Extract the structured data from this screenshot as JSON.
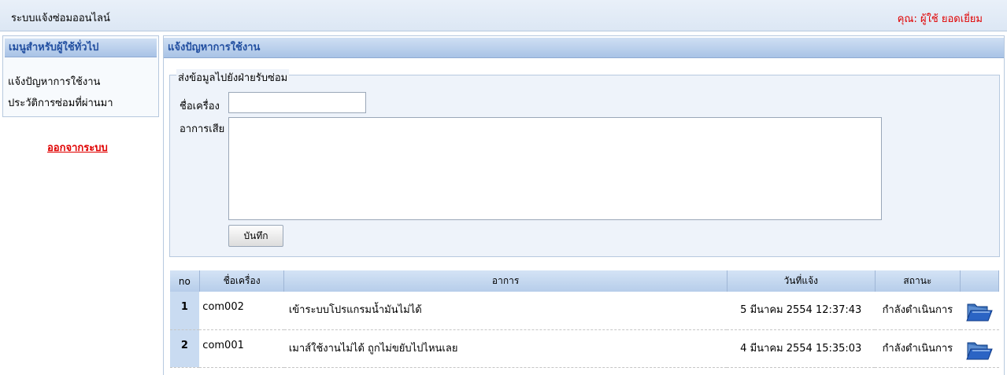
{
  "header": {
    "app_title": "ระบบแจ้งซ่อมออนไลน์",
    "user_label": "คุณ: ผู้ใช้ ยอดเยี่ยม"
  },
  "sidebar": {
    "title": "เมนูสำหรับผู้ใช้ทั่วไป",
    "items": [
      {
        "label": "แจ้งปัญหาการใช้งาน"
      },
      {
        "label": "ประวัติการซ่อมที่ผ่านมา"
      }
    ],
    "logout_label": "ออกจากระบบ"
  },
  "main": {
    "title": "แจ้งปัญหาการใช้งาน",
    "form": {
      "legend": "ส่งข้อมูลไปยังฝ่ายรับซ่อม",
      "machine_label": "ชื่อเครื่อง",
      "machine_value": "",
      "symptom_label": "อาการเสีย",
      "symptom_value": "",
      "save_label": "บันทึก"
    },
    "table": {
      "headers": {
        "no": "no",
        "machine": "ชื่อเครื่อง",
        "symptom": "อาการ",
        "date": "วันที่แจ้ง",
        "status": "สถานะ",
        "action": ""
      },
      "rows": [
        {
          "no": "1",
          "machine": "com002",
          "symptom": "เข้าระบบโปรแกรมน้ำมันไม่ได้",
          "date": "5 มีนาคม 2554 12:37:43",
          "status": "กำลังดำเนินการ",
          "icon": "open-folder-icon"
        },
        {
          "no": "2",
          "machine": "com001",
          "symptom": "เมาส์ใช้งานไม่ได้ ถูกไม่ขยับไปไหนเลย",
          "date": "4 มีนาคม 2554 15:35:03",
          "status": "กำลังดำเนินการ",
          "icon": "open-folder-icon"
        }
      ]
    }
  },
  "colors": {
    "accent_red": "#e00000",
    "header_blue": "#224fa0",
    "panel_bg": "#eef3fa"
  }
}
